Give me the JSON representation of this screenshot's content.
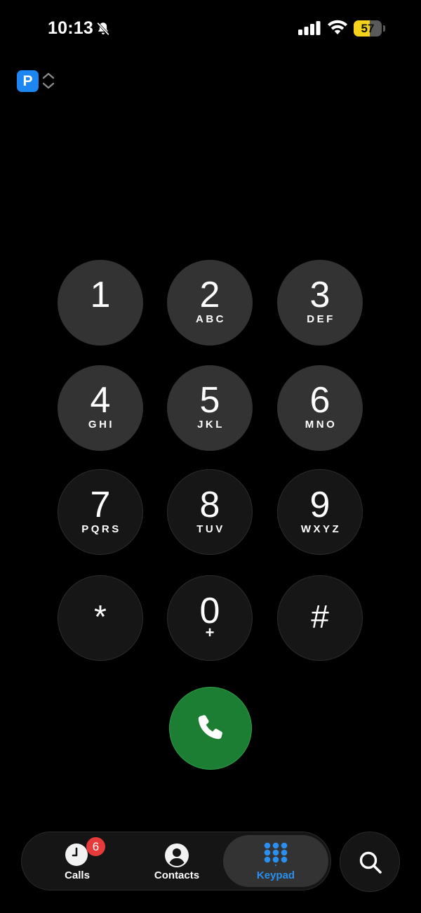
{
  "status_bar": {
    "time": "10:13",
    "battery": "57",
    "battery_level": 0.57,
    "battery_color": "#f4d21c",
    "icons": [
      "bell-slash-icon",
      "cellular-signal-icon",
      "wifi-icon",
      "battery-icon"
    ]
  },
  "account": {
    "badge": "P"
  },
  "keypad": {
    "keys": [
      {
        "digit": "1",
        "letters": ""
      },
      {
        "digit": "2",
        "letters": "ABC"
      },
      {
        "digit": "3",
        "letters": "DEF"
      },
      {
        "digit": "4",
        "letters": "GHI"
      },
      {
        "digit": "5",
        "letters": "JKL"
      },
      {
        "digit": "6",
        "letters": "MNO"
      },
      {
        "digit": "7",
        "letters": "PQRS"
      },
      {
        "digit": "8",
        "letters": "TUV"
      },
      {
        "digit": "9",
        "letters": "WXYZ"
      },
      {
        "digit": "*",
        "letters": ""
      },
      {
        "digit": "0",
        "letters": "+"
      },
      {
        "digit": "#",
        "letters": ""
      }
    ],
    "call_button_color": "#1b7e32"
  },
  "tabs": {
    "calls": {
      "label": "Calls",
      "badge": "6"
    },
    "contacts": {
      "label": "Contacts"
    },
    "keypad": {
      "label": "Keypad",
      "active": true,
      "accent_color": "#2b8ff0"
    }
  }
}
